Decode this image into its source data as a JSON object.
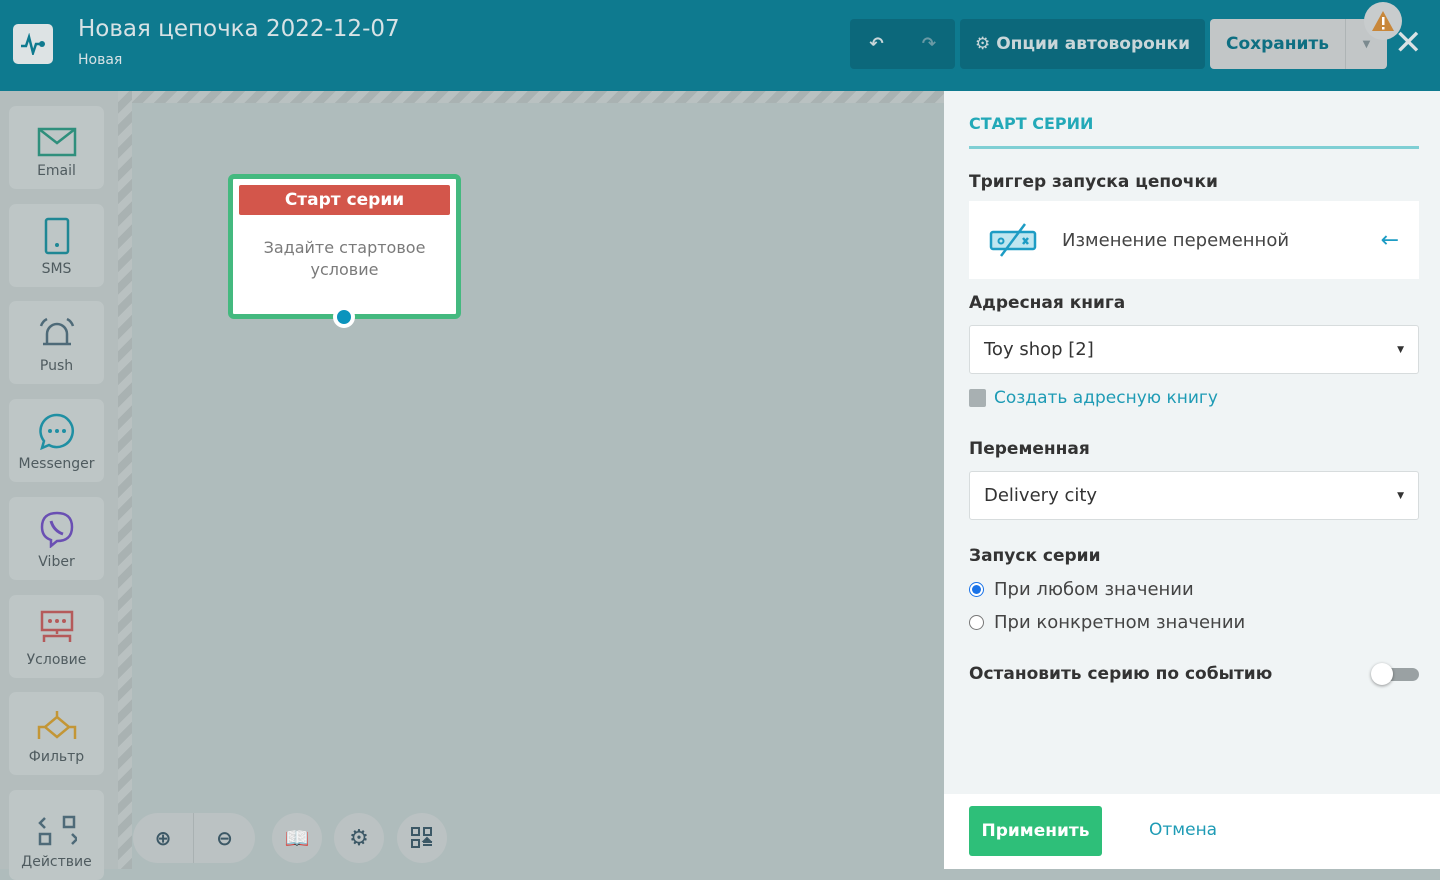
{
  "header": {
    "title": "Новая цепочка 2022-12-07",
    "status": "Новая",
    "options_label": "Опции автоворонки",
    "save_label": "Сохранить"
  },
  "sidebar": {
    "items": [
      {
        "label": "Email"
      },
      {
        "label": "SMS"
      },
      {
        "label": "Push"
      },
      {
        "label": "Messenger"
      },
      {
        "label": "Viber"
      },
      {
        "label": "Условие"
      },
      {
        "label": "Фильтр"
      },
      {
        "label": "Действие"
      }
    ]
  },
  "canvas": {
    "node": {
      "title": "Старт серии",
      "body": "Задайте стартовое условие"
    }
  },
  "panel": {
    "title": "СТАРТ СЕРИИ",
    "trigger_label": "Триггер запуска цепочки",
    "trigger_value": "Изменение переменной",
    "addressbook_label": "Адресная книга",
    "addressbook_value": "Toy shop [2]",
    "create_addressbook": "Создать адресную книгу",
    "variable_label": "Переменная",
    "variable_value": "Delivery city",
    "launch_label": "Запуск серии",
    "radio_any": "При любом значении",
    "radio_specific": "При конкретном значении",
    "stop_label": "Остановить серию по событию",
    "stop_enabled": false,
    "apply": "Применить",
    "cancel": "Отмена"
  },
  "colors": {
    "header": "#0e7a8f",
    "accent": "#23a9b8",
    "apply": "#2ebf79",
    "node_head": "#d3564b"
  }
}
